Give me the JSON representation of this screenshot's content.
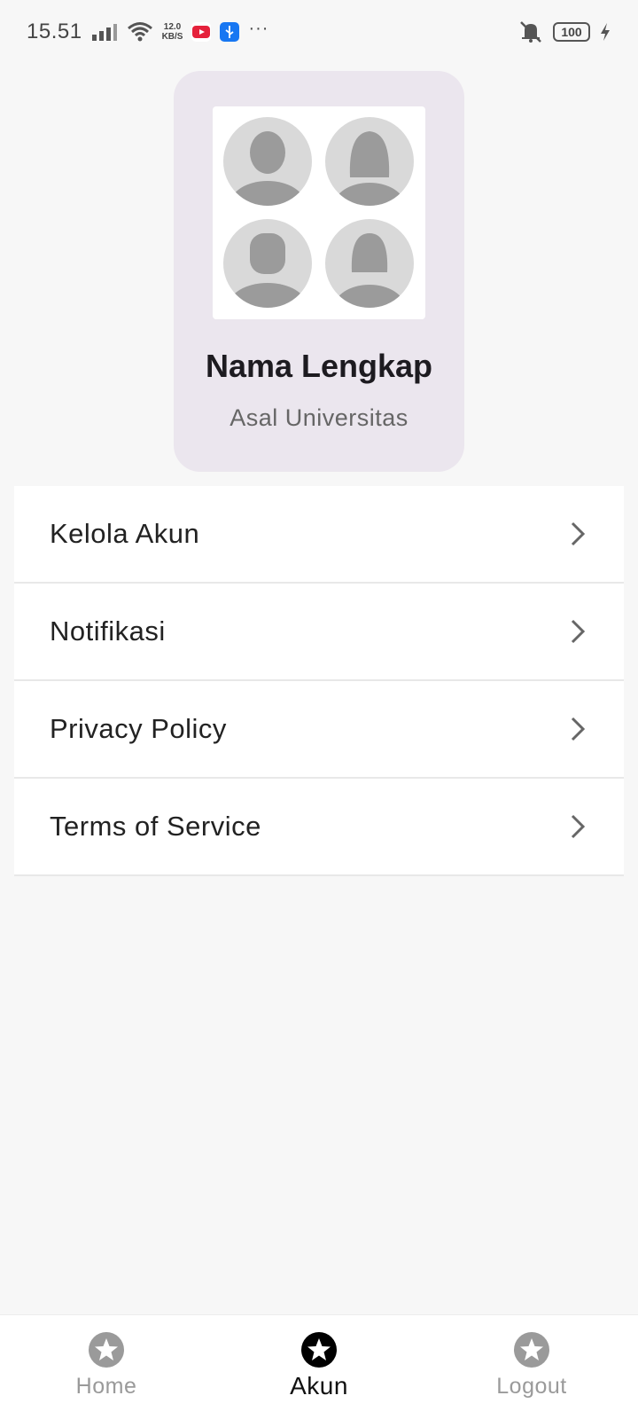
{
  "status_bar": {
    "time": "15.51",
    "net_speed_value": "12.0",
    "net_speed_unit": "KB/S",
    "battery": "100",
    "icons": [
      "signal-icon",
      "wifi-icon",
      "youtube-icon",
      "usb-icon",
      "more-dots-icon",
      "mute-icon",
      "battery-icon",
      "charging-icon"
    ]
  },
  "profile": {
    "name": "Nama Lengkap",
    "university": "Asal Universitas",
    "card_color": "#ebe6ee"
  },
  "menu": {
    "items": [
      {
        "label": "Kelola Akun"
      },
      {
        "label": "Notifikasi"
      },
      {
        "label": "Privacy Policy"
      },
      {
        "label": "Terms of Service"
      }
    ]
  },
  "bottom_nav": {
    "items": [
      {
        "label": "Home",
        "icon": "star-icon",
        "active": false
      },
      {
        "label": "Akun",
        "icon": "star-icon",
        "active": true
      },
      {
        "label": "Logout",
        "icon": "star-icon",
        "active": false
      }
    ],
    "active_color": "#000000",
    "inactive_color": "#9a9a9a"
  }
}
